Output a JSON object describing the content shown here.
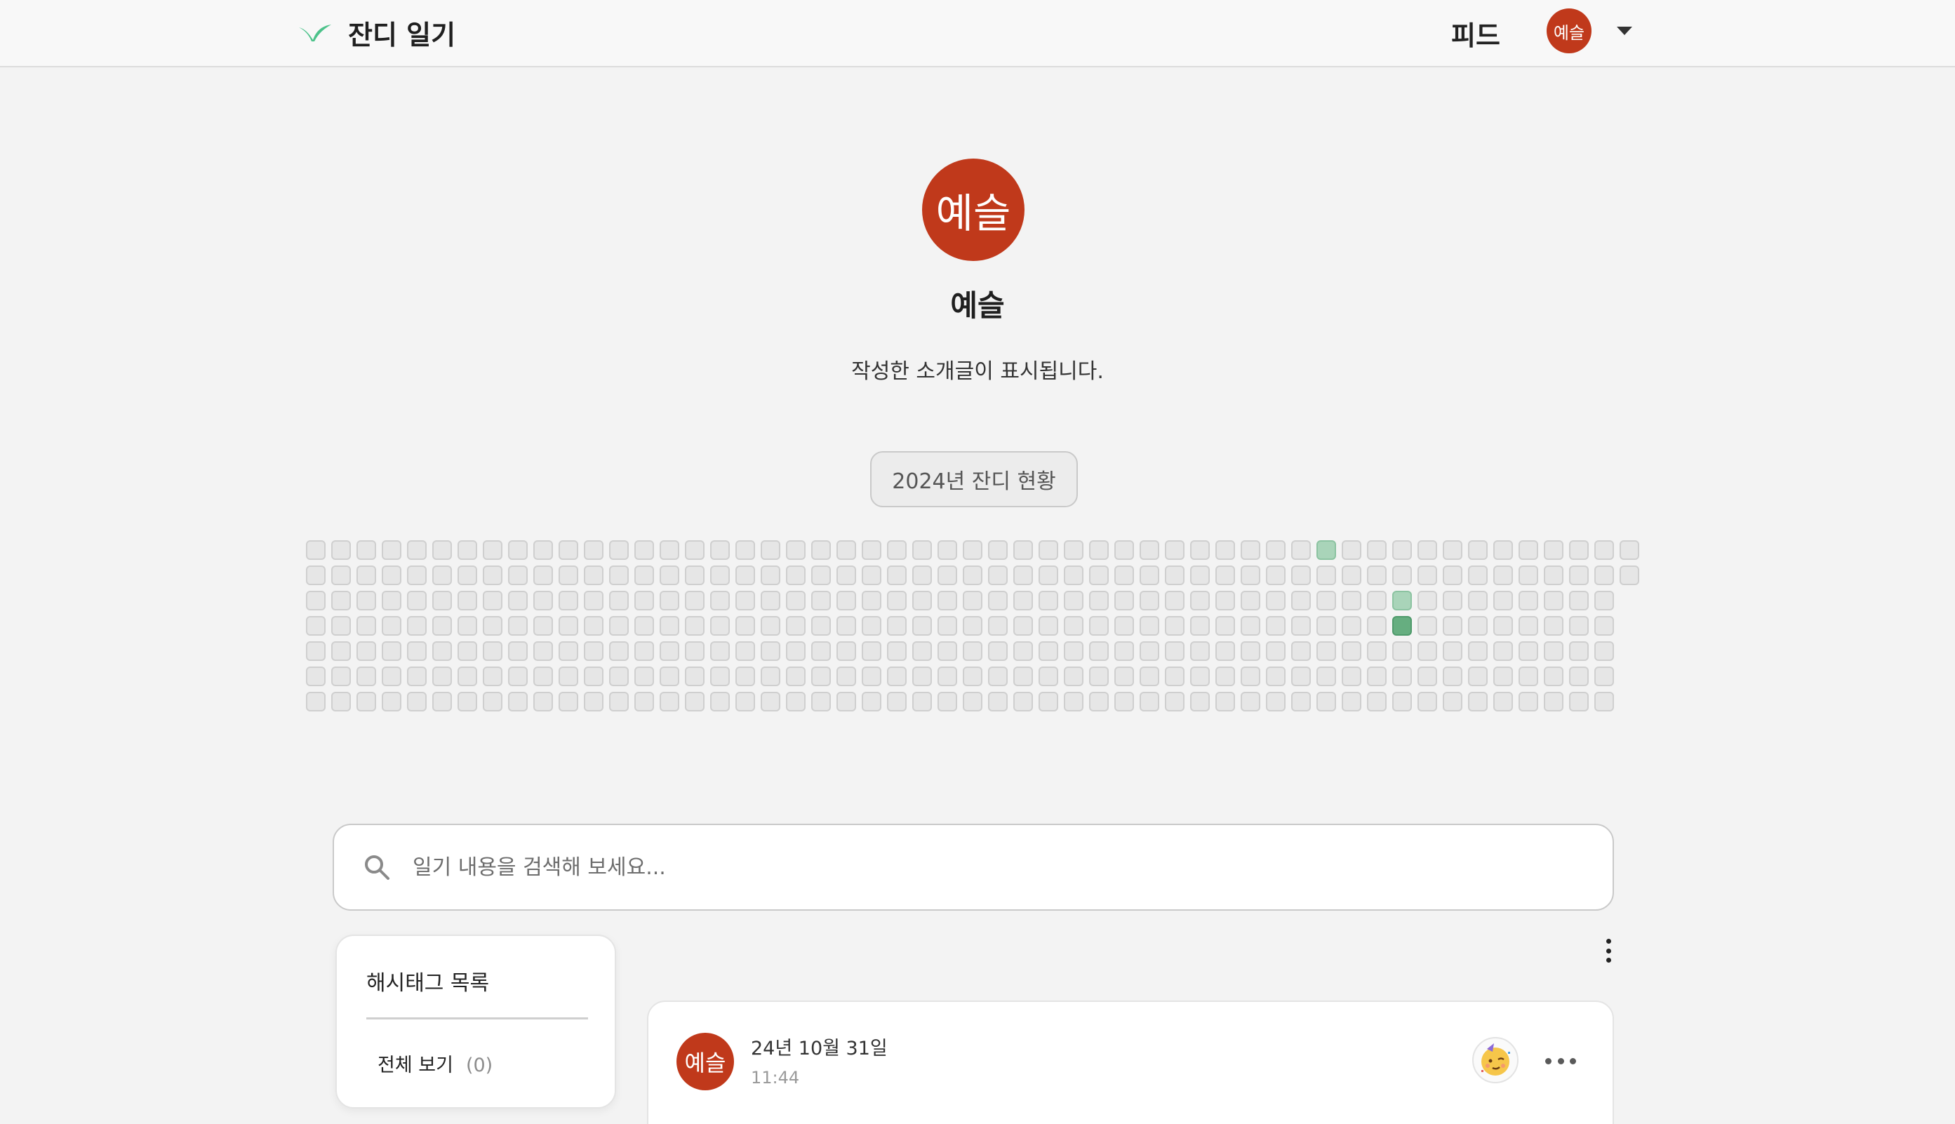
{
  "header": {
    "app_name": "잔디 일기",
    "feed_label": "피드",
    "user_avatar_text": "예슬"
  },
  "profile": {
    "avatar_text": "예슬",
    "name": "예슬",
    "bio": "작성한 소개글이 표시됩니다."
  },
  "grass": {
    "title": "2024년 잔디 현황",
    "weeks": 53,
    "days_per_week": 7,
    "last_week_days": 2,
    "active_cells": [
      {
        "week": 40,
        "day": 0,
        "level": 1
      },
      {
        "week": 43,
        "day": 2,
        "level": 1
      },
      {
        "week": 43,
        "day": 3,
        "level": 2
      }
    ],
    "colors": {
      "empty": "#e6e6e6",
      "level1": "#a9d4b9",
      "level2": "#66ae80"
    }
  },
  "search": {
    "placeholder": "일기 내용을 검색해 보세요...",
    "value": ""
  },
  "hashtags": {
    "title": "해시태그 목록",
    "all_label": "전체 보기",
    "all_count": "(0)"
  },
  "post": {
    "avatar_text": "예슬",
    "date": "24년 10월 31일",
    "time": "11:44",
    "emotion_icon": "partying-face-icon"
  },
  "colors": {
    "accent": "#c0391b",
    "grass_green": "#66ae80"
  }
}
